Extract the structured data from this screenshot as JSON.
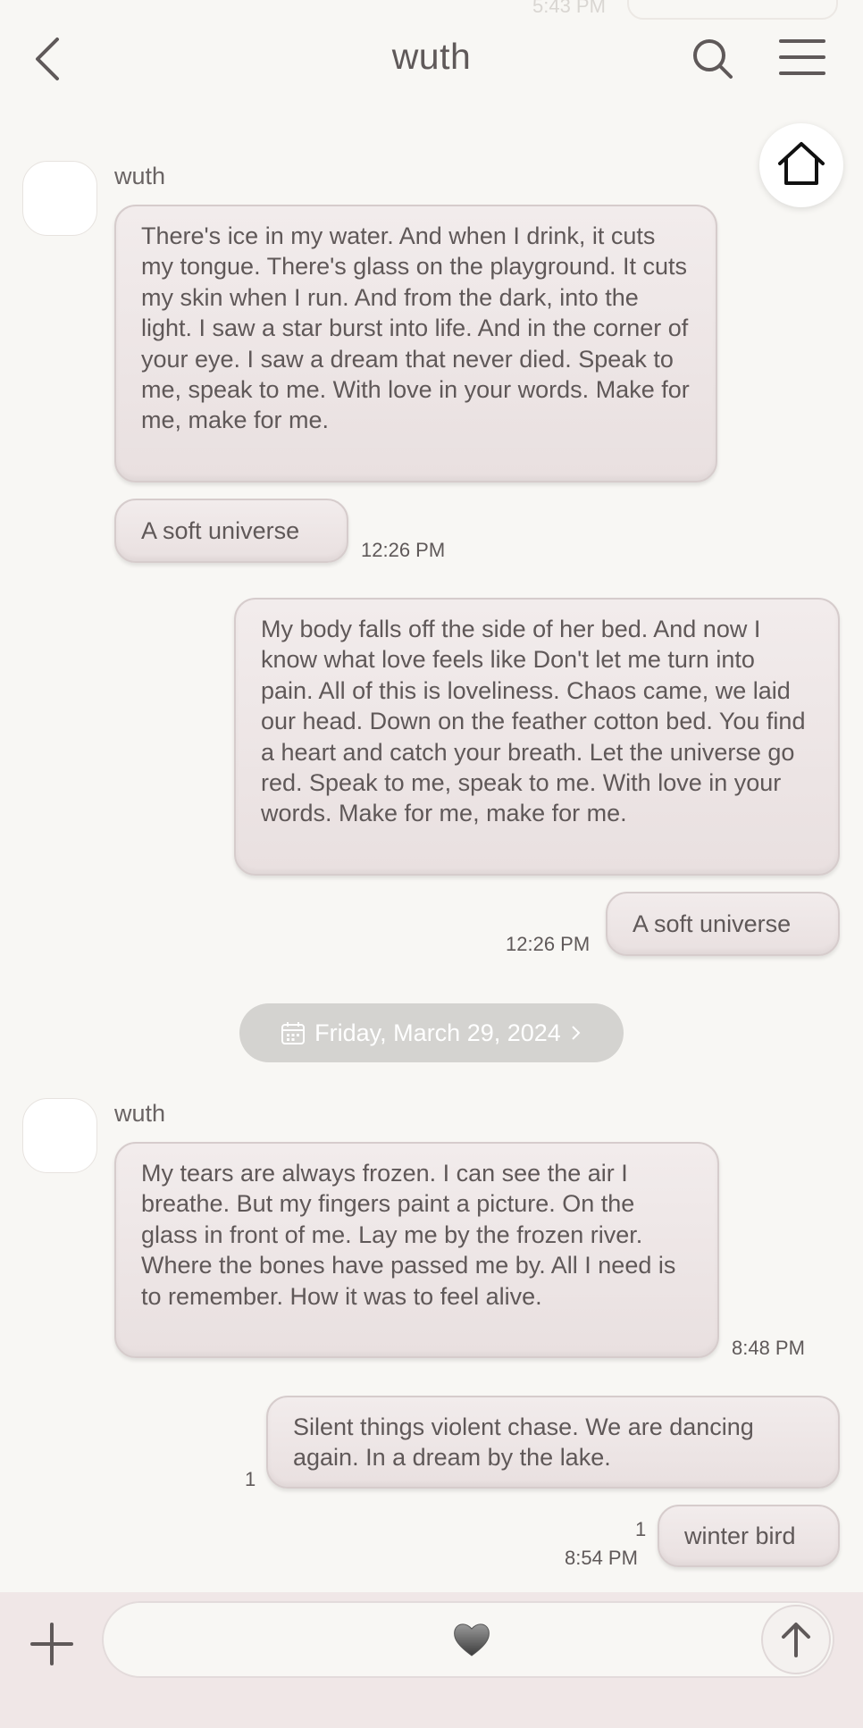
{
  "status_ghost": {
    "time": "5:43 PM"
  },
  "header": {
    "title": "wuth"
  },
  "icons": {
    "back": "chevron-left-icon",
    "search": "search-icon",
    "menu": "hamburger-menu-icon",
    "home": "home-icon",
    "calendar": "calendar-icon",
    "plus": "plus-icon",
    "heart": "heart-icon",
    "send": "arrow-up-icon"
  },
  "messages": [
    {
      "sender": "wuth",
      "text": "There's ice in my water. And when I drink, it cuts my tongue. There's glass on the playground. It cuts my skin when I run. And from the dark, into the light. I saw a star burst into life. And in the corner of your eye. I saw a dream that never died. Speak to me, speak to me. With love in your words. Make for me, make for me.",
      "caption": "A soft universe",
      "time": "12:26 PM"
    },
    {
      "text": "My body falls off the side of her bed. And now I know what love feels like Don't let me turn into pain. All of this is loveliness. Chaos came, we laid our head. Down on the feather cotton bed. You find a heart and catch your breath. Let the universe go red. Speak to me, speak to me. With love in your words. Make for me, make for me.",
      "caption": "A soft universe",
      "time": "12:26 PM"
    },
    {
      "date": "Friday, March 29, 2024"
    },
    {
      "sender": "wuth",
      "text": "My tears are always frozen. I can see the air I breathe. But my fingers paint a picture. On the glass in front of me. Lay me by the frozen river. Where the bones have passed me by. All I need is to remember. How it was to feel alive.",
      "time": "8:48 PM"
    },
    {
      "text": "Silent things violent chase. We are dancing again. In a dream by the lake.",
      "unread": "1"
    },
    {
      "text": "winter bird",
      "unread": "1",
      "time": "8:54 PM"
    }
  ],
  "composer": {
    "placeholder": ""
  },
  "colors": {
    "background": "#f8f7f4",
    "bubble": "#eee6e6",
    "bubble_border": "#d6cccc",
    "date_pill": "#d4d3d0",
    "bottom_bar": "#f0e7e7"
  }
}
